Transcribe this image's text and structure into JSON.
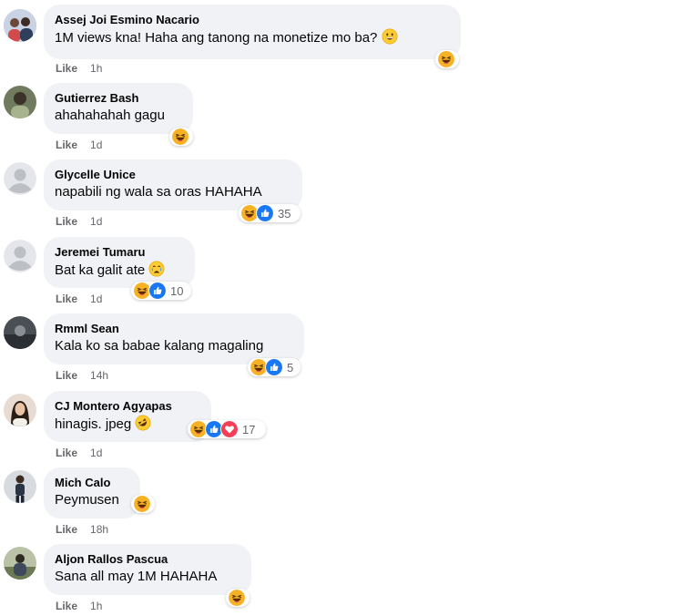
{
  "comments": [
    {
      "author": "Assej Joi Esmino Nacario",
      "text": "1M views kna! Haha ang tanong na monetize mo ba?",
      "like_label": "Like",
      "time": "1h",
      "reaction_count": ""
    },
    {
      "author": "Gutierrez Bash",
      "text": "ahahahahah gagu",
      "like_label": "Like",
      "time": "1d",
      "reaction_count": ""
    },
    {
      "author": "Glycelle Unice",
      "text": "napabili ng wala sa oras HAHAHA",
      "like_label": "Like",
      "time": "1d",
      "reaction_count": "35"
    },
    {
      "author": "Jeremei Tumaru",
      "text": "Bat ka galit ate",
      "like_label": "Like",
      "time": "1d",
      "reaction_count": "10"
    },
    {
      "author": "Rmml Sean",
      "text": "Kala ko sa babae kalang magaling",
      "like_label": "Like",
      "time": "14h",
      "reaction_count": "5"
    },
    {
      "author": "CJ Montero Agyapas",
      "text": "hinagis. jpeg",
      "like_label": "Like",
      "time": "1d",
      "reaction_count": "17"
    },
    {
      "author": "Mich Calo",
      "text": "Peymusen",
      "like_label": "Like",
      "time": "18h",
      "reaction_count": ""
    },
    {
      "author": "Aljon Rallos Pascua",
      "text": "Sana all may 1M HAHAHA",
      "like_label": "Like",
      "time": "1h",
      "reaction_count": ""
    }
  ],
  "icons": {
    "haha": "haha-reaction-icon",
    "like": "like-reaction-icon",
    "love": "love-reaction-icon",
    "grin_emoji": "grinning-emoji-icon",
    "crying_emoji": "crying-emoji-icon",
    "rofl_emoji": "rolling-laughing-emoji-icon",
    "default_avatar": "default-avatar-icon"
  },
  "colors": {
    "bubble_bg": "#f0f2f5",
    "meta_text": "#65676b",
    "like_blue": "#1877f2",
    "love_red": "#f33e58",
    "haha_yellow": "#f7b125"
  }
}
